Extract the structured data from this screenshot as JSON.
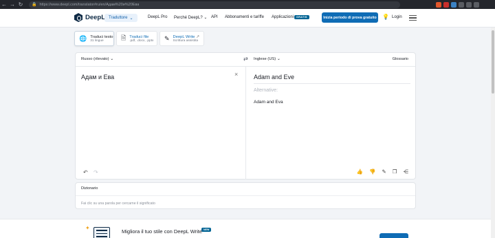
{
  "browser": {
    "url": "https://www.deepl.com/translator#ru/en/Адам%20и%20Ева",
    "nav": [
      "←",
      "→",
      "↻"
    ]
  },
  "header": {
    "brand": "DeepL",
    "product_button": "Traduttore",
    "links": [
      "DeepL Pro",
      "Perché DeepL?",
      "API",
      "Abbonamenti e tariffe",
      "Applicazioni"
    ],
    "new_badge": "GRATIS",
    "trial_button": "Inizia periodo di prova gratuito",
    "login": "Login"
  },
  "modes": [
    {
      "title": "Traduci testo",
      "subtitle": "31 lingue"
    },
    {
      "title": "Traduci file",
      "subtitle": ".pdf, .docx, .pptx"
    },
    {
      "title": "DeepL Write",
      "subtitle": "Scrittura assistita"
    }
  ],
  "translator": {
    "source_lang": "Russo (rilevato)",
    "target_lang": "Inglese (US)",
    "glossary": "Glossario",
    "source_text": "Адам и Ева",
    "target_text": "Adam and Eve",
    "alternatives_label": "Alternative:",
    "alternative": "Adam and Eva"
  },
  "dictionary": {
    "title": "Dizionario",
    "hint": "Fai clic su una parola per cercarne il significato"
  },
  "promo": {
    "text": "Migliora il tuo stile con DeepL Write",
    "badge": "NEW"
  },
  "colors": {
    "brand": "#0f2b46",
    "accent": "#0f6cb5",
    "badge": "#006494"
  }
}
